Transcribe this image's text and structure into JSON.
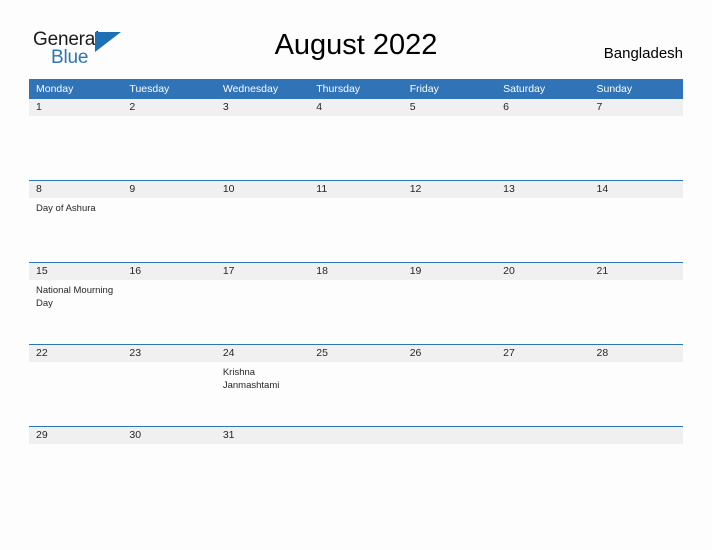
{
  "brand": {
    "name_part1": "General",
    "name_part2": "Blue",
    "accent_color": "#2E75B6",
    "triangle_icon": "logo-triangle-icon"
  },
  "header": {
    "title": "August 2022",
    "country": "Bangladesh"
  },
  "calendar": {
    "header_bg": "#3073B7",
    "daynum_bg": "#F0F0F0",
    "row_border": "#2E75B6",
    "weekday_headers": [
      "Monday",
      "Tuesday",
      "Wednesday",
      "Thursday",
      "Friday",
      "Saturday",
      "Sunday"
    ],
    "weeks": [
      [
        {
          "day": "1",
          "events": []
        },
        {
          "day": "2",
          "events": []
        },
        {
          "day": "3",
          "events": []
        },
        {
          "day": "4",
          "events": []
        },
        {
          "day": "5",
          "events": []
        },
        {
          "day": "6",
          "events": []
        },
        {
          "day": "7",
          "events": []
        }
      ],
      [
        {
          "day": "8",
          "events": [
            "Day of Ashura"
          ]
        },
        {
          "day": "9",
          "events": []
        },
        {
          "day": "10",
          "events": []
        },
        {
          "day": "11",
          "events": []
        },
        {
          "day": "12",
          "events": []
        },
        {
          "day": "13",
          "events": []
        },
        {
          "day": "14",
          "events": []
        }
      ],
      [
        {
          "day": "15",
          "events": [
            "National Mourning Day"
          ]
        },
        {
          "day": "16",
          "events": []
        },
        {
          "day": "17",
          "events": []
        },
        {
          "day": "18",
          "events": []
        },
        {
          "day": "19",
          "events": []
        },
        {
          "day": "20",
          "events": []
        },
        {
          "day": "21",
          "events": []
        }
      ],
      [
        {
          "day": "22",
          "events": []
        },
        {
          "day": "23",
          "events": []
        },
        {
          "day": "24",
          "events": [
            "Krishna Janmashtami"
          ]
        },
        {
          "day": "25",
          "events": []
        },
        {
          "day": "26",
          "events": []
        },
        {
          "day": "27",
          "events": []
        },
        {
          "day": "28",
          "events": []
        }
      ],
      [
        {
          "day": "29",
          "events": []
        },
        {
          "day": "30",
          "events": []
        },
        {
          "day": "31",
          "events": []
        },
        {
          "day": "",
          "events": []
        },
        {
          "day": "",
          "events": []
        },
        {
          "day": "",
          "events": []
        },
        {
          "day": "",
          "events": []
        }
      ]
    ]
  }
}
